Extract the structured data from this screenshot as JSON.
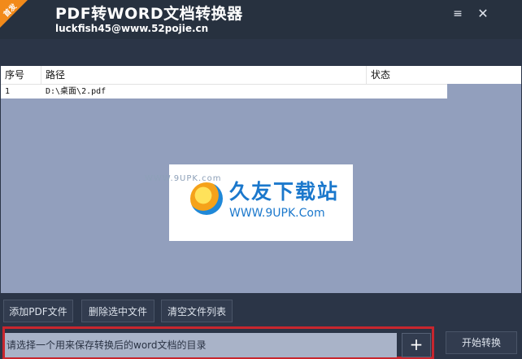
{
  "window": {
    "badge": "首发",
    "title": "PDF转WORD文档转换器",
    "subtitle": "luckfish45@www.52pojie.cn",
    "minimize_glyph": "≡",
    "close_glyph": "✕"
  },
  "table": {
    "columns": [
      "序号",
      "路径",
      "状态"
    ],
    "rows": [
      {
        "index": "1",
        "path": "D:\\桌面\\2.pdf",
        "status": ""
      }
    ]
  },
  "watermark": {
    "logo_text": "WWW.9UPK.com",
    "name": "久友下载站",
    "url": "WWW.9UPK.Com"
  },
  "toolbar": {
    "add_label": "添加PDF文件",
    "delete_label": "删除选中文件",
    "clear_label": "清空文件列表",
    "dir_placeholder": "请选择一个用来保存转换后的word文档的目录",
    "plus_label": "+",
    "start_label": "开始转换"
  },
  "colors": {
    "background": "#2b3547",
    "file_area": "#929fbd",
    "highlight": "#c8262e",
    "badge": "#f28a1a"
  }
}
